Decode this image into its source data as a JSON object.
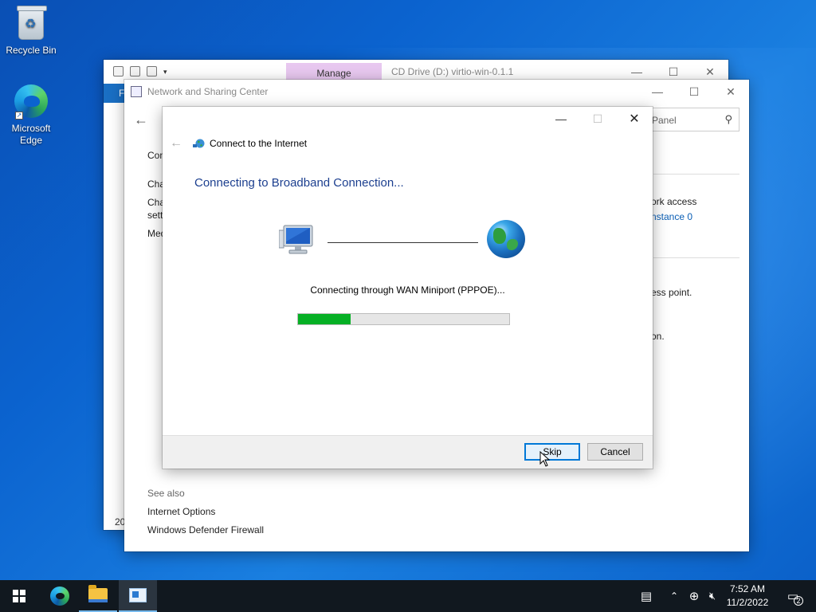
{
  "desktop": {
    "icons": [
      {
        "label": "Recycle Bin",
        "icon": "recycle-bin-icon"
      },
      {
        "label": "Microsoft Edge",
        "icon": "edge-icon"
      }
    ]
  },
  "explorer_window": {
    "manage_tab": "Manage",
    "title": "CD Drive (D:) virtio-win-0.1.1",
    "file_tab": "F",
    "bottom_text": "20"
  },
  "nsc_window": {
    "title": "Network and Sharing Center",
    "search_placeholder": "Panel",
    "left_items": [
      "Con",
      "Cha",
      "Cha",
      "sett",
      "Med"
    ],
    "right_texts": {
      "network_access": "ork access",
      "instance": "nstance 0",
      "access_point": "ess point.",
      "period": "on."
    },
    "see_also": {
      "heading": "See also",
      "links": [
        "Internet Options",
        "Windows Defender Firewall"
      ]
    }
  },
  "dialog": {
    "title": "Connect to the Internet",
    "heading": "Connecting to Broadband Connection...",
    "status": "Connecting through WAN Miniport (PPPOE)...",
    "progress": 0.25,
    "buttons": {
      "skip": "Skip",
      "cancel": "Cancel"
    }
  },
  "taskbar": {
    "apps": [
      "start",
      "edge",
      "file-explorer",
      "network-and-sharing-center"
    ],
    "time": "7:52 AM",
    "date": "11/2/2022",
    "notification_count": "2"
  },
  "colors": {
    "accent": "#0078d7",
    "progress_green": "#06b025",
    "heading_blue": "#1c3f8f",
    "manage_tab": "#e8c8f0"
  }
}
